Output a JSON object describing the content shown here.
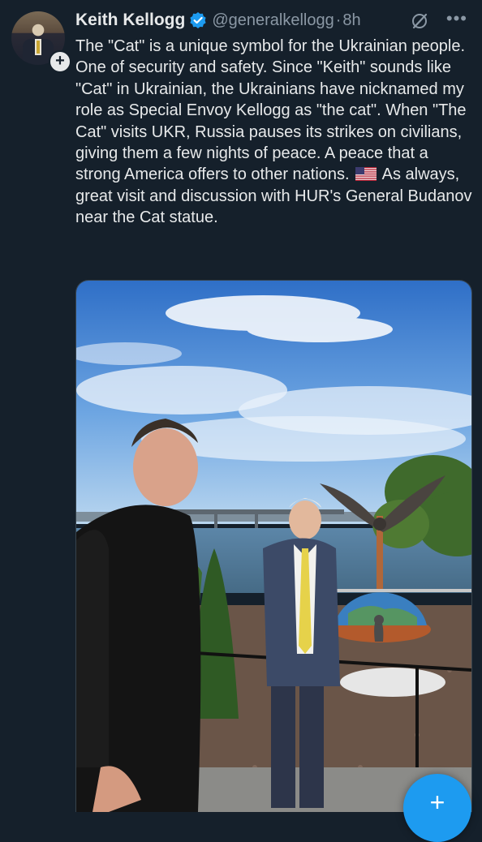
{
  "tweet": {
    "author_name": "Keith Kellogg",
    "handle": "@generalkellogg",
    "separator": "·",
    "time": "8h",
    "text_part1": "The \"Cat\" is a unique symbol for the Ukrainian people. One of security and safety. Since \"Keith\" sounds like \"Cat\" in Ukrainian, the Ukrainians have nicknamed my role as Special Envoy Kellogg as \"the cat\". When \"The Cat\" visits UKR, Russia pauses its strikes on civilians, giving them a few nights of peace. A peace that a strong America offers to other nations. ",
    "text_part2": " As always, great visit and discussion with HUR's General Budanov near the Cat statue.",
    "follow_symbol": "+",
    "more_symbol": "•••"
  },
  "icons": {
    "verified": "verified-badge-icon",
    "flag": "us-flag-emoji",
    "grok": "grok-icon",
    "more": "more-icon"
  },
  "compose_fab": {
    "symbol": "+"
  },
  "colors": {
    "background": "#15202b",
    "text": "#e7e9ea",
    "secondary": "#8b98a5",
    "accent": "#1d9bf0"
  }
}
